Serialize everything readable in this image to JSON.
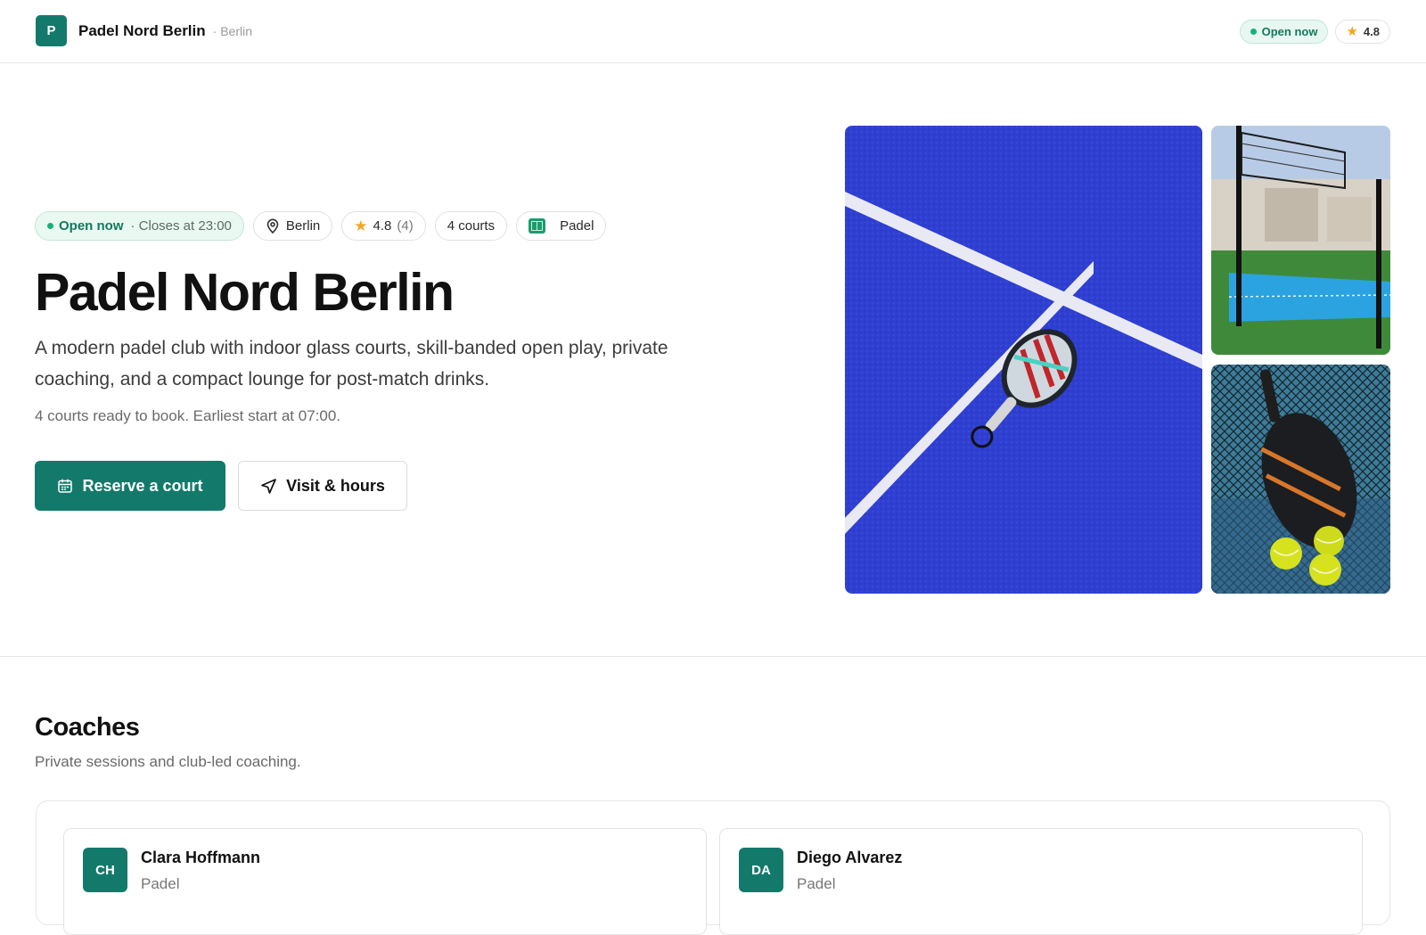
{
  "header": {
    "brand_initial": "P",
    "brand_name": "Padel Nord Berlin",
    "brand_city": "· Berlin",
    "status": "Open now",
    "rating": "4.8"
  },
  "hero": {
    "chips": {
      "open": "Open now",
      "closes": "· Closes at 23:00",
      "city": "Berlin",
      "rating": "4.8",
      "rating_count": "(4)",
      "courts": "4 courts",
      "sport": "Padel"
    },
    "title": "Padel Nord Berlin",
    "description": "A modern padel club with indoor glass courts, skill-banded open play, private coaching, and a compact lounge for post-match drinks.",
    "subtext": "4 courts ready to book. Earliest start at 07:00.",
    "primary_button": "Reserve a court",
    "secondary_button": "Visit & hours"
  },
  "coaches": {
    "title": "Coaches",
    "subtitle": "Private sessions and club-led coaching.",
    "items": [
      {
        "initials": "CH",
        "name": "Clara Hoffmann",
        "sport": "Padel"
      },
      {
        "initials": "DA",
        "name": "Diego Alvarez",
        "sport": "Padel"
      }
    ]
  },
  "colors": {
    "brand": "#137a6b",
    "status_green": "#16b27a",
    "star": "#f4a524",
    "court_blue": "#2f3fd1"
  },
  "icons": {
    "location": "map-pin-icon",
    "star": "star-icon",
    "calendar": "calendar-icon",
    "navigate": "navigation-arrow-icon",
    "sport": "court-icon"
  }
}
